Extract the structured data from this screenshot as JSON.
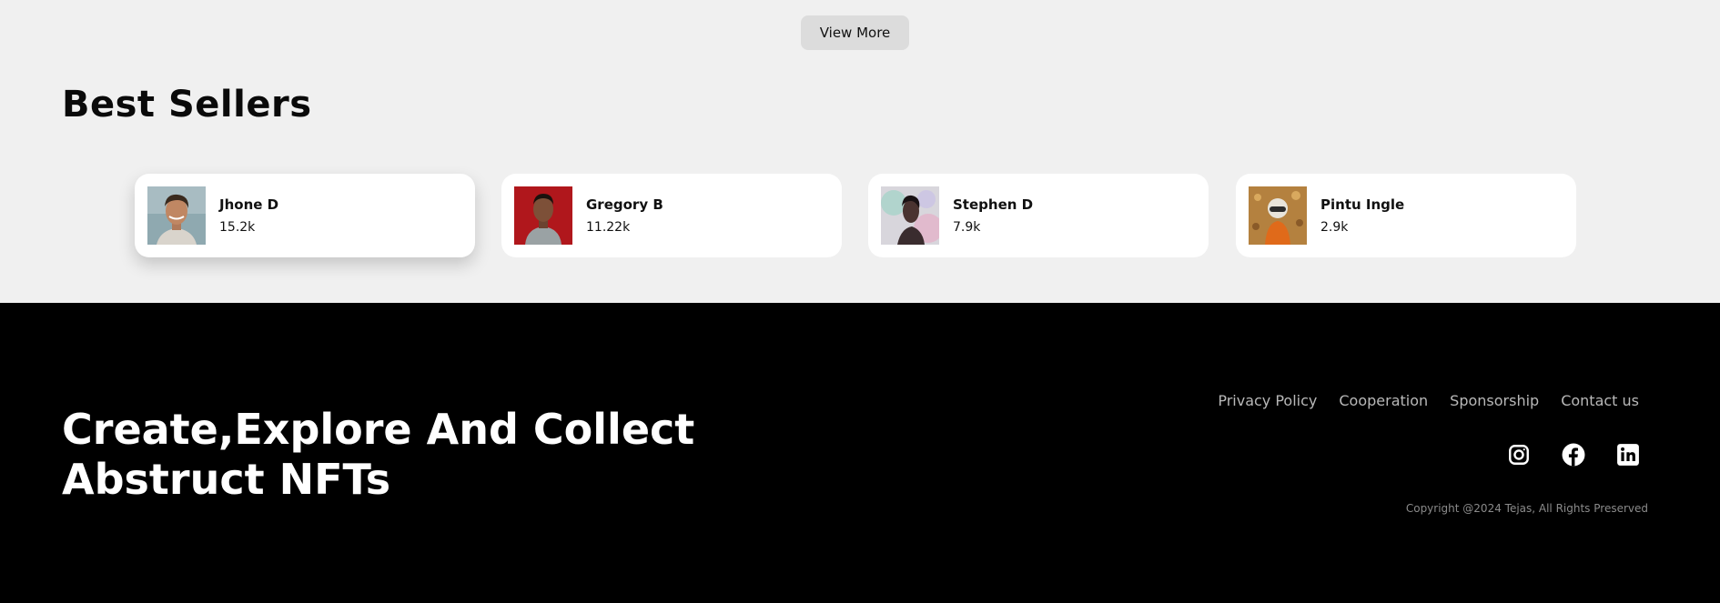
{
  "view_more": {
    "label": "View More"
  },
  "best_sellers": {
    "title": "Best Sellers",
    "sellers": [
      {
        "name": "Jhone D",
        "value": "15.2k",
        "avatar": "man-smiling-portrait"
      },
      {
        "name": "Gregory B",
        "value": "11.22k",
        "avatar": "man-red-background-portrait"
      },
      {
        "name": "Stephen D",
        "value": "7.9k",
        "avatar": "woman-abstract-portrait"
      },
      {
        "name": "Pintu Ingle",
        "value": "2.9k",
        "avatar": "astronaut-orange-portrait"
      }
    ]
  },
  "footer": {
    "title_line1": "Create,Explore And Collect",
    "title_line2": "Abstruct NFTs",
    "links": [
      "Privacy Policy",
      "Cooperation",
      "Sponsorship",
      "Contact us"
    ],
    "socials": [
      "instagram-icon",
      "facebook-icon",
      "linkedin-icon"
    ],
    "copyright": "Copyright @2024 Tejas, All Rights Preserved"
  }
}
